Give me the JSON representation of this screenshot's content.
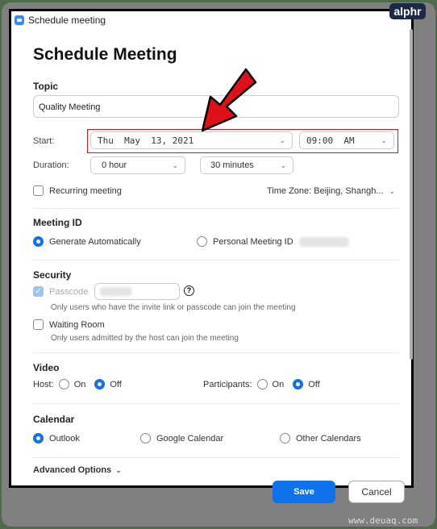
{
  "window": {
    "title": "Schedule meeting"
  },
  "heading": "Schedule Meeting",
  "topic": {
    "label": "Topic",
    "value": "Quality Meeting"
  },
  "start": {
    "label": "Start:",
    "date": "Thu  May  13, 2021",
    "time": "09:00  AM"
  },
  "duration": {
    "label": "Duration:",
    "hours": "0 hour",
    "minutes": "30 minutes"
  },
  "recurring": {
    "label": "Recurring meeting",
    "checked": false
  },
  "timezone": "Time Zone: Beijing, Shangh...",
  "meeting_id": {
    "label": "Meeting ID",
    "generate": "Generate Automatically",
    "personal": "Personal Meeting ID",
    "selected": "generate"
  },
  "security": {
    "label": "Security",
    "passcode": "Passcode",
    "passcode_checked": true,
    "passcode_hint": "Only users who have the invite link or passcode can join the meeting",
    "help": "?",
    "waiting_room": "Waiting Room",
    "waiting_checked": false,
    "waiting_hint": "Only users admitted by the host can join the meeting"
  },
  "video": {
    "label": "Video",
    "host": "Host:",
    "participants": "Participants:",
    "on": "On",
    "off": "Off",
    "host_value": "Off",
    "participants_value": "Off"
  },
  "calendar": {
    "label": "Calendar",
    "options": [
      "Outlook",
      "Google Calendar",
      "Other Calendars"
    ],
    "selected": "Outlook"
  },
  "advanced": "Advanced Options",
  "buttons": {
    "save": "Save",
    "cancel": "Cancel"
  },
  "badge": "alphr",
  "watermark": "www.deuaq.com",
  "colors": {
    "accent": "#0e72ed",
    "highlight": "#e0101a"
  }
}
